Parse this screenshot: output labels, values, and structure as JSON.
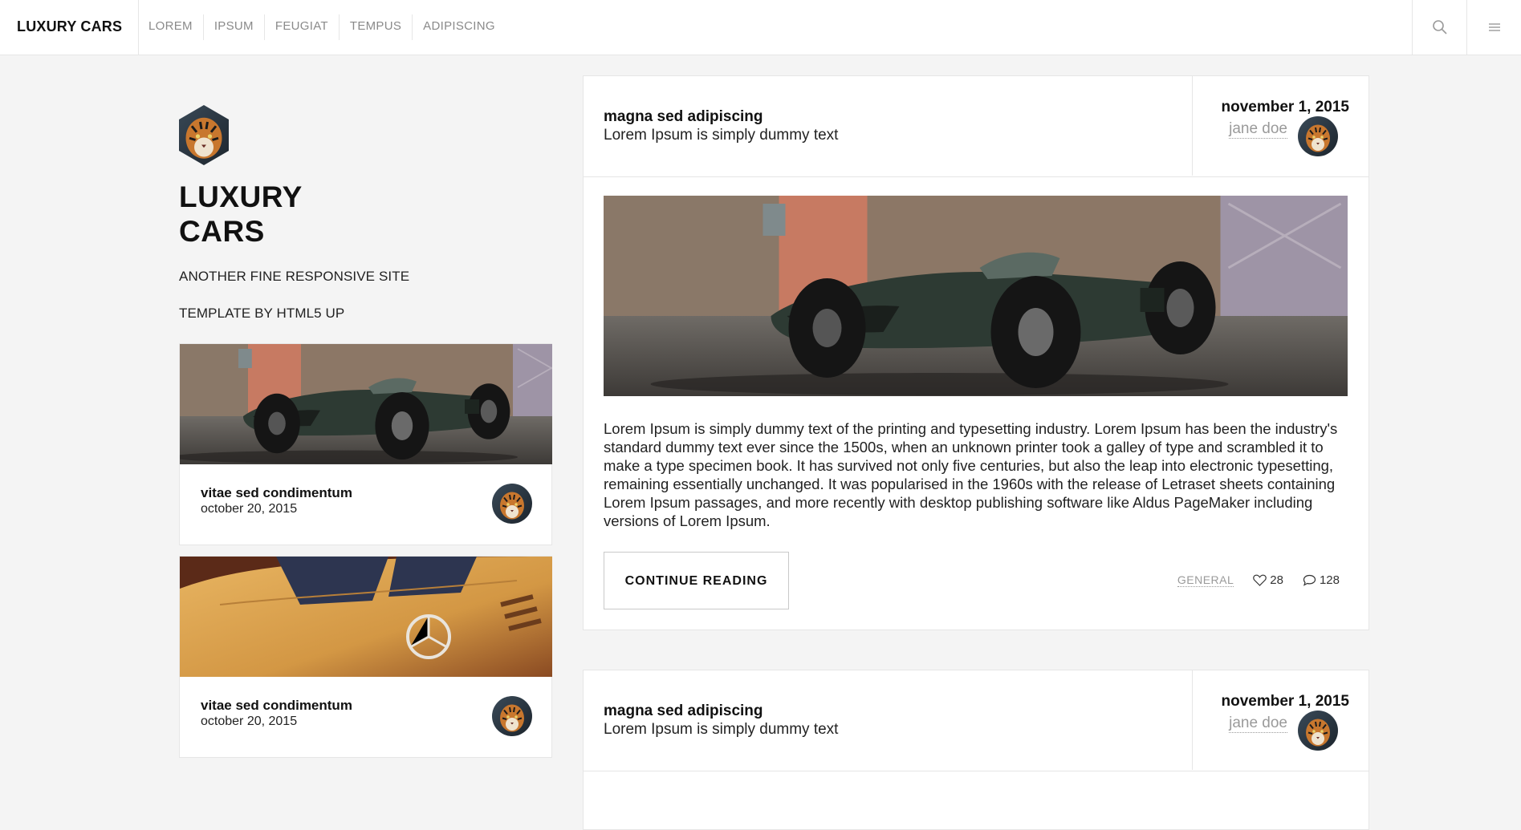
{
  "header": {
    "brand": "LUXURY CARS",
    "nav": [
      "LOREM",
      "IPSUM",
      "FEUGIAT",
      "TEMPUS",
      "ADIPISCING"
    ],
    "search_icon": "search-icon",
    "menu_icon": "menu-icon"
  },
  "sidebar": {
    "title_line1": "LUXURY",
    "title_line2": "CARS",
    "tagline1": "ANOTHER FINE RESPONSIVE SITE",
    "tagline2": "TEMPLATE BY HTML5 UP",
    "posts": [
      {
        "title": "vitae sed condimentum",
        "date": "october 20, 2015"
      },
      {
        "title": "vitae sed condimentum",
        "date": "october 20, 2015"
      }
    ]
  },
  "posts": [
    {
      "title": "magna sed adipiscing",
      "subtitle": "Lorem Ipsum is simply dummy text",
      "date": "november 1, 2015",
      "author": "jane doe",
      "body": "Lorem Ipsum is simply dummy text of the printing and typesetting industry. Lorem Ipsum has been the industry's standard dummy text ever since the 1500s, when an unknown printer took a galley of type and scrambled it to make a type specimen book. It has survived not only five centuries, but also the leap into electronic typesetting, remaining essentially unchanged. It was popularised in the 1960s with the release of Letraset sheets containing Lorem Ipsum passages, and more recently with desktop publishing software like Aldus PageMaker including versions of Lorem Ipsum.",
      "button": "CONTINUE READING",
      "category": "GENERAL",
      "likes": "28",
      "comments": "128"
    },
    {
      "title": "magna sed adipiscing",
      "subtitle": "Lorem Ipsum is simply dummy text",
      "date": "november 1, 2015",
      "author": "jane doe"
    }
  ]
}
